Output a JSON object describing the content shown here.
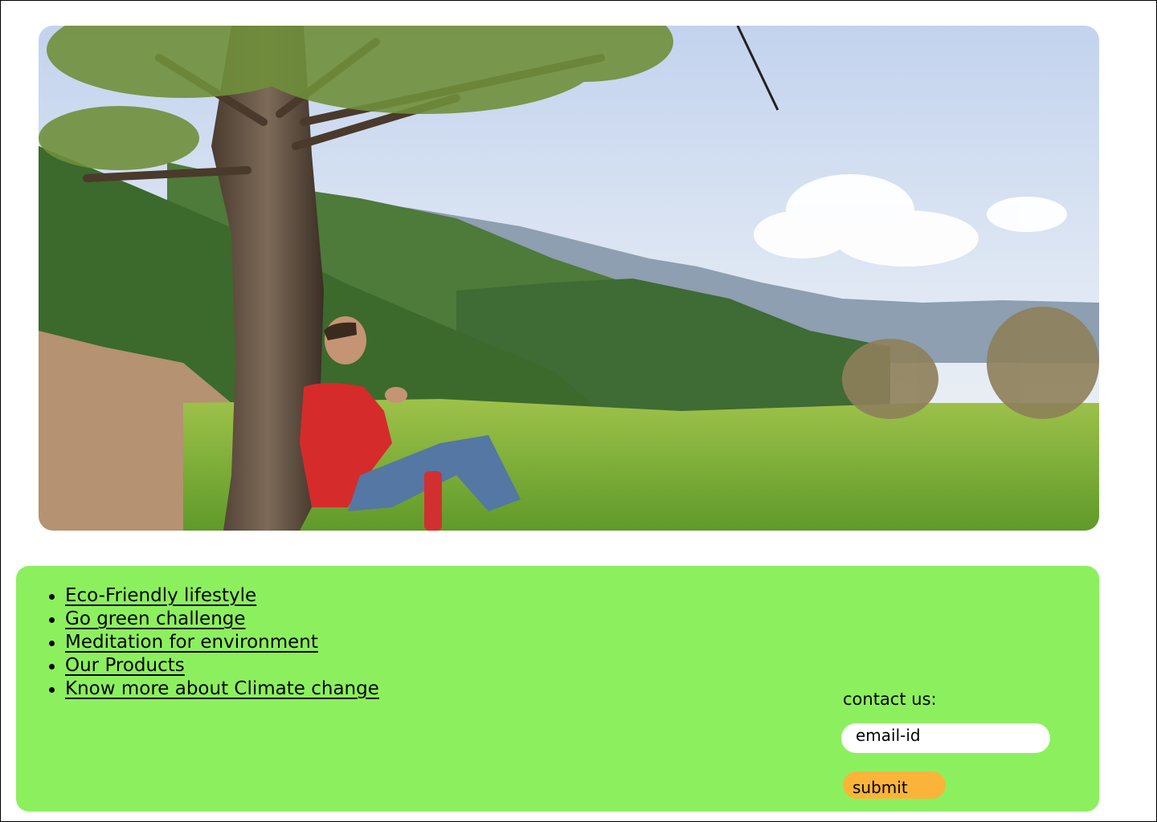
{
  "hero": {
    "image_name": "man-relaxing-under-tree-in-mountain-meadow",
    "alt": ""
  },
  "nav": {
    "items": [
      {
        "label": "Eco-Friendly lifestyle"
      },
      {
        "label": "Go green challenge"
      },
      {
        "label": "Meditation for environment"
      },
      {
        "label": "Our Products"
      },
      {
        "label": "Know more about Climate change"
      }
    ]
  },
  "contact": {
    "label": "contact us:",
    "email_placeholder": "email-id",
    "submit_label": "submit"
  },
  "colors": {
    "panel_bg": "#8cf05e",
    "submit_bg": "#fbb43a",
    "input_bg": "#ffffff"
  }
}
